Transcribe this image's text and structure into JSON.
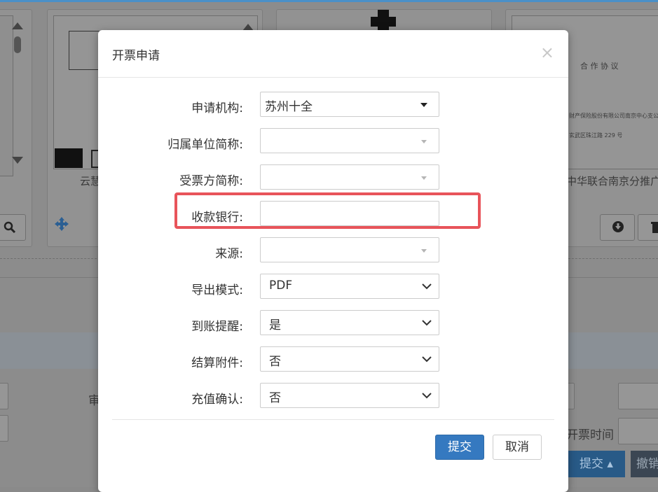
{
  "background": {
    "card1_caption": "云慧",
    "card4_caption": "中华联合南京分推广",
    "card4_doc_title": "合 作 协 议",
    "card4_doc_line1": "财产保险股份有限公司南京中心支公司",
    "card4_doc_line2": "玄武区珠江路 229 号",
    "partial_label_left": "审",
    "label_right": "开票时间",
    "submit_label": "提交",
    "revoke_label": "撤销"
  },
  "modal": {
    "title": "开票申请",
    "close_symbol": "×",
    "fields": [
      {
        "label": "申请机构:",
        "value": "苏州十全",
        "type": "select"
      },
      {
        "label": "归属单位简称:",
        "value": "",
        "type": "select-disabled"
      },
      {
        "label": "受票方简称:",
        "value": "",
        "type": "select-disabled"
      },
      {
        "label": "收款银行:",
        "value": "",
        "type": "input"
      },
      {
        "label": "来源:",
        "value": "",
        "type": "select-disabled"
      },
      {
        "label": "导出模式:",
        "value": "PDF",
        "type": "native-select"
      },
      {
        "label": "到账提醒:",
        "value": "是",
        "type": "native-select"
      },
      {
        "label": "结算附件:",
        "value": "否",
        "type": "native-select"
      },
      {
        "label": "充值确认:",
        "value": "否",
        "type": "native-select"
      }
    ],
    "submit_label": "提交",
    "cancel_label": "取消"
  },
  "colors": {
    "primary": "#3579c0",
    "highlight": "#e8545a",
    "overlay": "#8c8c8c"
  }
}
